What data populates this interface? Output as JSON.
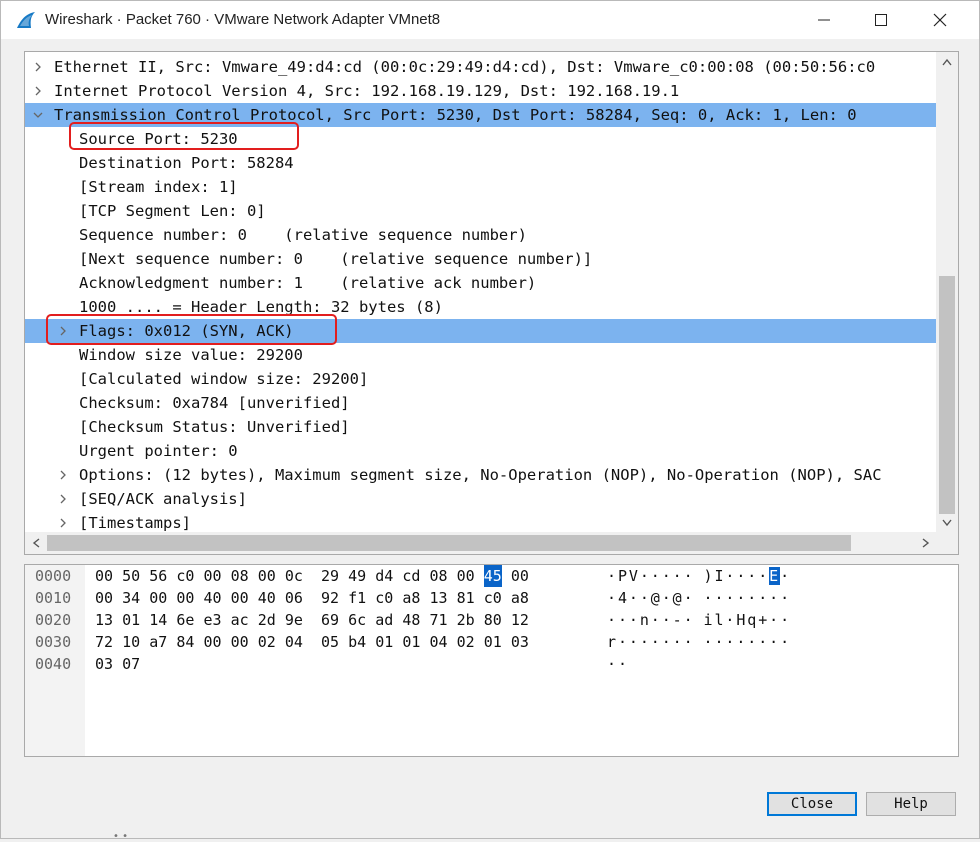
{
  "window": {
    "title": "Wireshark · Packet 760 · VMware Network Adapter VMnet8",
    "icon": "wireshark-fin-icon",
    "controls": [
      "minimize-icon",
      "maximize-icon",
      "close-icon"
    ]
  },
  "tree": {
    "rows": [
      {
        "text": "Ethernet II, Src: Vmware_49:d4:cd (00:0c:29:49:d4:cd), Dst: Vmware_c0:00:08 (00:50:56:c0",
        "level": 0,
        "arrow": "collapsed",
        "selected": false
      },
      {
        "text": "Internet Protocol Version 4, Src: 192.168.19.129, Dst: 192.168.19.1",
        "level": 0,
        "arrow": "collapsed",
        "selected": false
      },
      {
        "text": "Transmission Control Protocol, Src Port: 5230, Dst Port: 58284, Seq: 0, Ack: 1, Len: 0",
        "level": 0,
        "arrow": "expanded",
        "selected": true
      },
      {
        "text": "Source Port: 5230",
        "level": 1,
        "arrow": "none",
        "selected": false
      },
      {
        "text": "Destination Port: 58284",
        "level": 1,
        "arrow": "none",
        "selected": false
      },
      {
        "text": "[Stream index: 1]",
        "level": 1,
        "arrow": "none",
        "selected": false
      },
      {
        "text": "[TCP Segment Len: 0]",
        "level": 1,
        "arrow": "none",
        "selected": false
      },
      {
        "text": "Sequence number: 0    (relative sequence number)",
        "level": 1,
        "arrow": "none",
        "selected": false
      },
      {
        "text": "[Next sequence number: 0    (relative sequence number)]",
        "level": 1,
        "arrow": "none",
        "selected": false
      },
      {
        "text": "Acknowledgment number: 1    (relative ack number)",
        "level": 1,
        "arrow": "none",
        "selected": false
      },
      {
        "text": "1000 .... = Header Length: 32 bytes (8)",
        "level": 1,
        "arrow": "none",
        "selected": false
      },
      {
        "text": "Flags: 0x012 (SYN, ACK)",
        "level": 1,
        "arrow": "collapsed",
        "selected": true
      },
      {
        "text": "Window size value: 29200",
        "level": 1,
        "arrow": "none",
        "selected": false
      },
      {
        "text": "[Calculated window size: 29200]",
        "level": 1,
        "arrow": "none",
        "selected": false
      },
      {
        "text": "Checksum: 0xa784 [unverified]",
        "level": 1,
        "arrow": "none",
        "selected": false
      },
      {
        "text": "[Checksum Status: Unverified]",
        "level": 1,
        "arrow": "none",
        "selected": false
      },
      {
        "text": "Urgent pointer: 0",
        "level": 1,
        "arrow": "none",
        "selected": false
      },
      {
        "text": "Options: (12 bytes), Maximum segment size, No-Operation (NOP), No-Operation (NOP), SAC",
        "level": 1,
        "arrow": "collapsed",
        "selected": false
      },
      {
        "text": "[SEQ/ACK analysis]",
        "level": 1,
        "arrow": "collapsed",
        "selected": false
      },
      {
        "text": "[Timestamps]",
        "level": 1,
        "arrow": "collapsed",
        "selected": false
      }
    ]
  },
  "hex": {
    "lines": [
      {
        "offset": "0000",
        "bytes": [
          "00",
          "50",
          "56",
          "c0",
          "00",
          "08",
          "00",
          "0c",
          "29",
          "49",
          "d4",
          "cd",
          "08",
          "00",
          "45",
          "00"
        ],
        "ascii": "·PV·····)I····E·",
        "highlight": 14
      },
      {
        "offset": "0010",
        "bytes": [
          "00",
          "34",
          "00",
          "00",
          "40",
          "00",
          "40",
          "06",
          "92",
          "f1",
          "c0",
          "a8",
          "13",
          "81",
          "c0",
          "a8"
        ],
        "ascii": "·4··@·@·········",
        "highlight": -1
      },
      {
        "offset": "0020",
        "bytes": [
          "13",
          "01",
          "14",
          "6e",
          "e3",
          "ac",
          "2d",
          "9e",
          "69",
          "6c",
          "ad",
          "48",
          "71",
          "2b",
          "80",
          "12"
        ],
        "ascii": "···n··-·il·Hq+··",
        "highlight": -1
      },
      {
        "offset": "0030",
        "bytes": [
          "72",
          "10",
          "a7",
          "84",
          "00",
          "00",
          "02",
          "04",
          "05",
          "b4",
          "01",
          "01",
          "04",
          "02",
          "01",
          "03"
        ],
        "ascii": "r···············",
        "highlight": -1
      },
      {
        "offset": "0040",
        "bytes": [
          "03",
          "07"
        ],
        "ascii": "··",
        "highlight": -1
      }
    ]
  },
  "buttons": {
    "close_label": "Close",
    "help_label": "Help"
  },
  "colors": {
    "selection": "#7cb3ef",
    "byte_highlight": "#0a64c8",
    "annotation": "#e21e1e"
  }
}
